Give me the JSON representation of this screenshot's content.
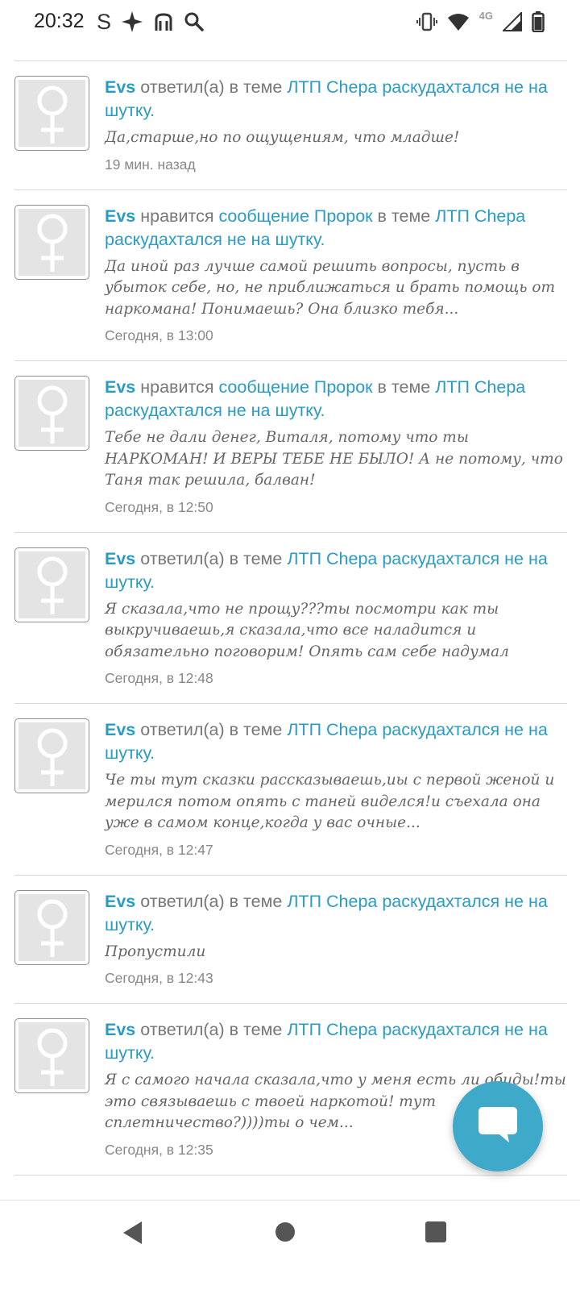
{
  "status_bar": {
    "time": "20:32",
    "left_icons": [
      "s-icon",
      "sparkle-icon",
      "bag-icon",
      "search-icon"
    ],
    "network": "4G",
    "right_icons": [
      "vibrate-icon",
      "wifi-icon",
      "signal-icon",
      "battery-icon"
    ]
  },
  "feed": {
    "items": [
      {
        "user": "Evs",
        "action": " ответил(а) в теме ",
        "topic": "ЛТП Chepa раскудахтался не на шутку",
        "snippet": "Да,старше,но по ощущениям, что младше!",
        "time": "19 мин. назад"
      },
      {
        "user": "Evs",
        "action": " нравится ",
        "message_link": "сообщение Пророк",
        "action2": " в теме ",
        "topic": "ЛТП Chepa раскудахтался не на шутку",
        "snippet": "Да иной раз лучше самой решить вопросы, пусть в убыток себе, но, не приближаться и брать помощь от наркомана! Понимаешь? Она близко тебя...",
        "time": "Сегодня, в 13:00"
      },
      {
        "user": "Evs",
        "action": " нравится ",
        "message_link": "сообщение Пророк",
        "action2": " в теме ",
        "topic": "ЛТП Chepa раскудахтался не на шутку",
        "snippet": "Тебе не дали денег, Виталя, потому что ты НАРКОМАН! И ВЕРЫ ТЕБЕ НЕ БЫЛО! А не потому, что Таня так решила, балван!",
        "time": "Сегодня, в 12:50"
      },
      {
        "user": "Evs",
        "action": " ответил(а) в теме ",
        "topic": "ЛТП Chepa раскудахтался не на шутку",
        "snippet": "Я сказала,что не прощу???ты посмотри как ты выкручиваешь,я сказала,что все наладится и обязательно поговорим! Опять сам себе надумал",
        "time": "Сегодня, в 12:48"
      },
      {
        "user": "Evs",
        "action": " ответил(а) в теме ",
        "topic": "ЛТП Chepa раскудахтался не на шутку",
        "snippet": "Че ты тут сказки рассказываешь,иы с первой женой и мерился потом опять с таней виделся!и съехала она уже в самом конце,когда у вас очные...",
        "time": "Сегодня, в 12:47"
      },
      {
        "user": "Evs",
        "action": " ответил(а) в теме ",
        "topic": "ЛТП Chepa раскудахтался не на шутку",
        "snippet": "Пропустили",
        "time": "Сегодня, в 12:43"
      },
      {
        "user": "Evs",
        "action": " ответил(а) в теме ",
        "topic": "ЛТП Chepa раскудахтался не на шутку",
        "snippet": "Я с самого начала сказала,что у меня есть ли обиды!ты это связываешь с твоей наркотой! тут сплетничество?))))ты о чем...",
        "time": "Сегодня, в 12:35"
      }
    ]
  },
  "fab": {
    "icon": "chat-bubble-icon"
  },
  "colors": {
    "accent": "#2a9bc4",
    "fab": "#3fa9c9"
  }
}
